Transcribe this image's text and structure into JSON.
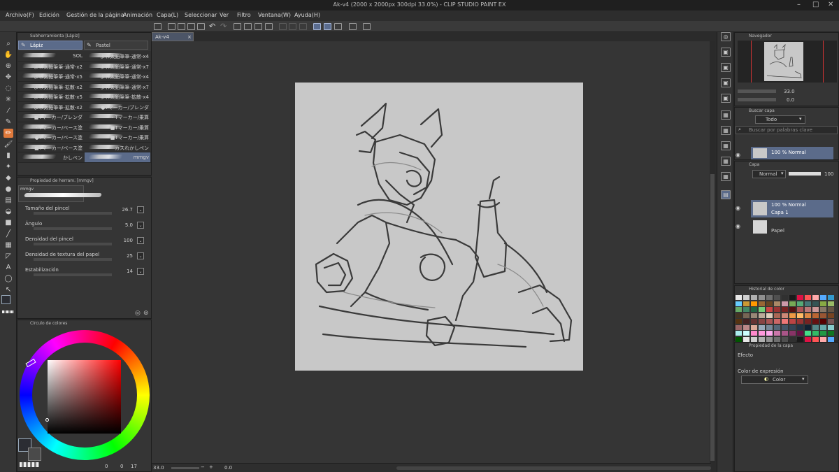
{
  "window": {
    "title": "Ak-v4 (2000 x 2000px 300dpi 33.0%) - CLIP STUDIO PAINT EX"
  },
  "menu": [
    "Archivo(F)",
    "Edición",
    "Gestión de la página",
    "Animación",
    "Capa(L)",
    "Seleccionar",
    "Ver",
    "Filtro",
    "Ventana(W)",
    "Ayuda(H)"
  ],
  "subtool": {
    "panel_title": "Subherramienta [Lápiz]",
    "tabs": [
      "Lápiz",
      "Pastel"
    ],
    "brushes": [
      [
        "SOL",
        "よわ太鉛筆筆-通常-x4"
      ],
      [
        "よわ太鉛筆筆-通常-x2",
        "よわ太鉛筆筆-通常-x7"
      ],
      [
        "よわ太鉛筆筆-通常-x5",
        "よわ太鉛筆筆-通常-x4"
      ],
      [
        "よわ太鉛筆筆-拡散-x2",
        "よわ太鉛筆筆-通常-x7"
      ],
      [
        "よわ太鉛筆筆-拡散-x5",
        "よわ太鉛筆筆-拡散-x4"
      ],
      [
        "よわ太鉛筆筆-拡散-x2",
        "●Tマーカー/ブレンダ"
      ],
      [
        "■Tマーカー/ブレンダ",
        "・Tマーカー/乗算"
      ],
      [
        "・Tマーカー/ベース塗",
        "■Tマーカー/乗算"
      ],
      [
        "●Tマーカー/ベース塗",
        "■Tマーカー/乗算"
      ],
      [
        "■Tマーカー/ベース塗",
        "カスれかしペン"
      ],
      [
        "かしペン",
        "mmgv"
      ]
    ]
  },
  "tool_property": {
    "panel_title": "Propiedad de herram. [mmgv]",
    "brush_name": "mmgv",
    "properties": [
      {
        "label": "Tamaño del pincel",
        "value": "26.7"
      },
      {
        "label": "Ángulo",
        "value": "5.0"
      },
      {
        "label": "Densidad del pincel",
        "value": "100"
      },
      {
        "label": "Densidad de textura del papel",
        "value": "25"
      },
      {
        "label": "Estabilización",
        "value": "14"
      }
    ]
  },
  "color_wheel": {
    "panel_title": "Círculo de colores",
    "footer_left": "0",
    "footer_mid": "0",
    "footer_right": "17",
    "main_color": "#2b2d33",
    "sub_color": "#4a4a4a"
  },
  "document": {
    "tab_label": "Ak-v4",
    "paper_color": "#c8c8c8"
  },
  "statusbar": {
    "zoom": "33.0",
    "angle": "0.0"
  },
  "navigator": {
    "panel_title": "Navegador",
    "zoom": "33.0",
    "angle": "0.0"
  },
  "layer_search": {
    "panel_title": "Buscar capa",
    "filter": "Todo",
    "placeholder": "Buscar por palabras clave",
    "result_label": "100 % Normal"
  },
  "layers": {
    "panel_title": "Capa",
    "blend_mode": "Normal",
    "opacity": "100",
    "items": [
      {
        "mode": "100 % Normal",
        "name": "Capa 1"
      },
      {
        "mode": "",
        "name": "Papel"
      }
    ]
  },
  "color_history": {
    "panel_title": "Historial de color"
  },
  "layer_property": {
    "panel_title": "Propiedad de la capa",
    "effect_label": "Efecto",
    "expression_label": "Color de expresión",
    "expression_value": "Color"
  }
}
